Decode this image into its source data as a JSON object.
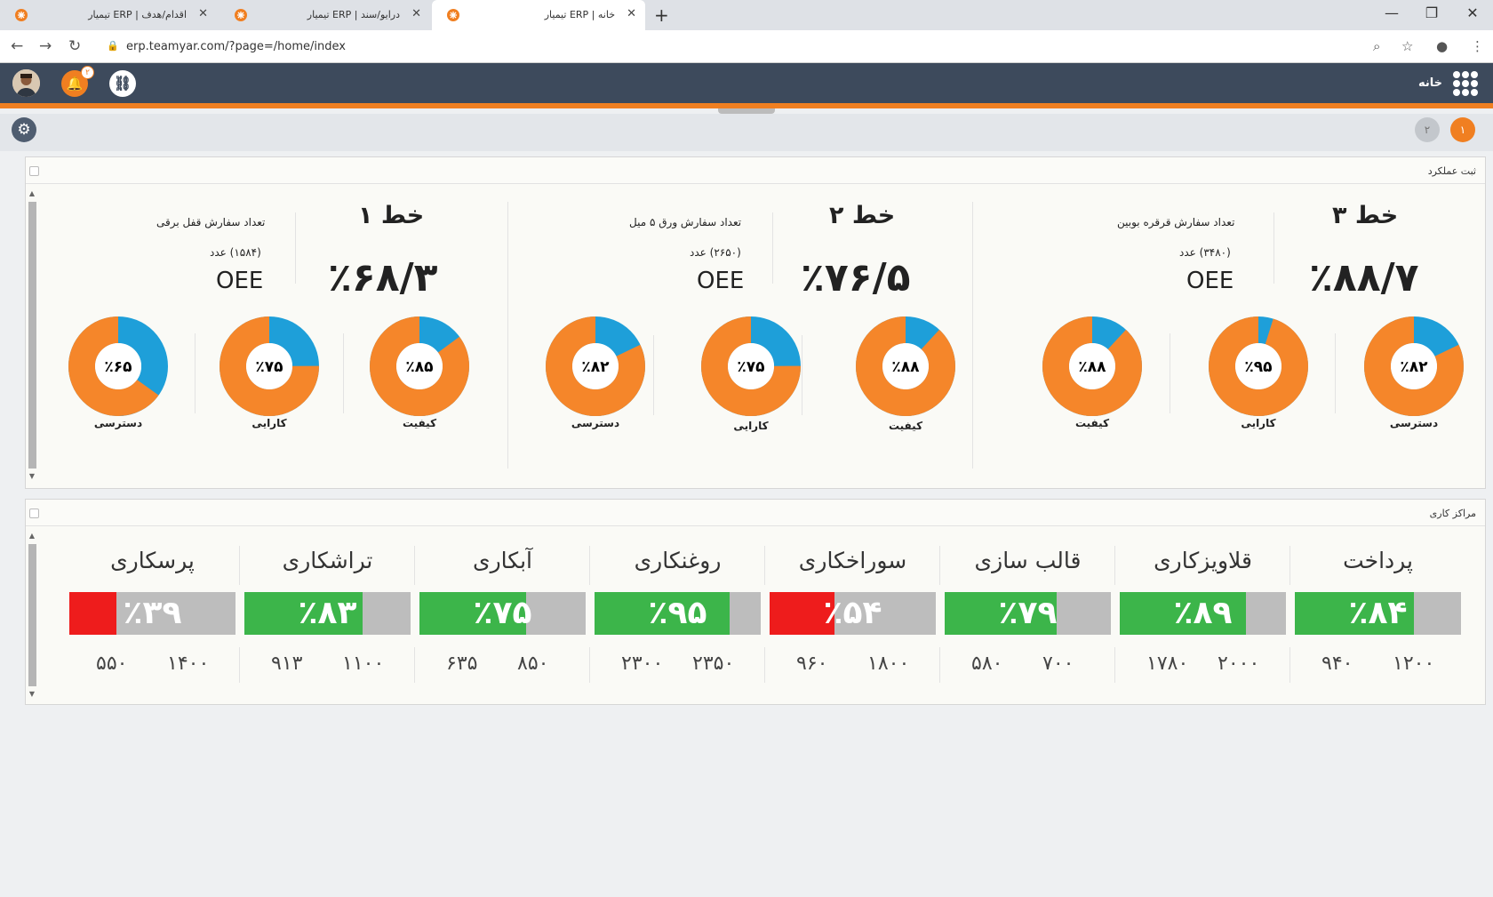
{
  "browser": {
    "tabs": [
      {
        "title": "اقدام/هدف | ERP تیمیار",
        "close": "✕",
        "active": false
      },
      {
        "title": "درایو/سند | ERP تیمیار",
        "close": "✕",
        "active": false
      },
      {
        "title": "خانه | ERP تیمیار",
        "close": "✕",
        "active": true
      }
    ],
    "new_tab": "+",
    "url": "erp.teamyar.com/?page=/home/index",
    "window_controls": {
      "minimize": "—",
      "restore": "❐",
      "close": "✕"
    }
  },
  "header": {
    "home_label": "خانه",
    "notification_count": "۲",
    "page_badges": [
      "۱",
      "۲"
    ],
    "accent_color": "#f07f21",
    "bar_color": "#3d4a5c"
  },
  "performance": {
    "title": "ثبت عملکرد",
    "lines": [
      {
        "name": "خط ۳",
        "oee_value": "٪۸۸/۷",
        "order_label": "تعداد سفارش قرقره بوبین",
        "order_count": "(۳۴۸۰) عدد",
        "oee_label": "OEE",
        "metrics": [
          {
            "label": "دسترسی",
            "value": "٪۸۲",
            "percent": 82
          },
          {
            "label": "کارایی",
            "value": "٪۹۵",
            "percent": 95
          },
          {
            "label": "کیفیت",
            "value": "٪۸۸",
            "percent": 88
          }
        ]
      },
      {
        "name": "خط ۲",
        "oee_value": "٪۷۶/۵",
        "order_label": "تعداد سفارش ورق ۵ میل",
        "order_count": "(۲۶۵۰) عدد",
        "oee_label": "OEE",
        "metrics": [
          {
            "label": "کیفیت",
            "value": "٪۸۸",
            "percent": 88
          },
          {
            "label": "کارایی",
            "value": "٪۷۵",
            "percent": 75
          },
          {
            "label": "دسترسی",
            "value": "٪۸۲",
            "percent": 82
          }
        ]
      },
      {
        "name": "خط ۱",
        "oee_value": "٪۶۸/۳",
        "order_label": "تعداد سفارش قفل برقی",
        "order_count": "(۱۵۸۴) عدد",
        "oee_label": "OEE",
        "metrics": [
          {
            "label": "کیفیت",
            "value": "٪۸۵",
            "percent": 85
          },
          {
            "label": "کارایی",
            "value": "٪۷۵",
            "percent": 75
          },
          {
            "label": "دسترسی",
            "value": "٪۶۵",
            "percent": 65
          }
        ]
      }
    ],
    "donut_colors": {
      "filled": "#f5862a",
      "remaining": "#1e9fd9"
    }
  },
  "work_centers": {
    "title": "مراکز کاری",
    "colors": {
      "good": "#3cb54a",
      "bad": "#ee1c1c",
      "track": "#bdbdbd"
    },
    "items": [
      {
        "name": "پرداخت",
        "pct": "٪۸۴",
        "percent": 84,
        "status": "good",
        "target": "۱۲۰۰",
        "actual": "۹۴۰"
      },
      {
        "name": "قلاویزکاری",
        "pct": "٪۸۹",
        "percent": 89,
        "status": "good",
        "target": "۲۰۰۰",
        "actual": "۱۷۸۰"
      },
      {
        "name": "قالب سازی",
        "pct": "٪۷۹",
        "percent": 79,
        "status": "good",
        "target": "۷۰۰",
        "actual": "۵۸۰"
      },
      {
        "name": "سوراخکاری",
        "pct": "٪۵۴",
        "percent": 54,
        "status": "bad",
        "target": "۱۸۰۰",
        "actual": "۹۶۰"
      },
      {
        "name": "روغنکاری",
        "pct": "٪۹۵",
        "percent": 95,
        "status": "good",
        "target": "۲۳۵۰",
        "actual": "۲۳۰۰"
      },
      {
        "name": "آبکاری",
        "pct": "٪۷۵",
        "percent": 75,
        "status": "good",
        "target": "۸۵۰",
        "actual": "۶۳۵"
      },
      {
        "name": "تراشکاری",
        "pct": "٪۸۳",
        "percent": 83,
        "status": "good",
        "target": "۱۱۰۰",
        "actual": "۹۱۳"
      },
      {
        "name": "پرسکاری",
        "pct": "٪۳۹",
        "percent": 39,
        "status": "bad",
        "target": "۱۴۰۰",
        "actual": "۵۵۰"
      }
    ]
  }
}
